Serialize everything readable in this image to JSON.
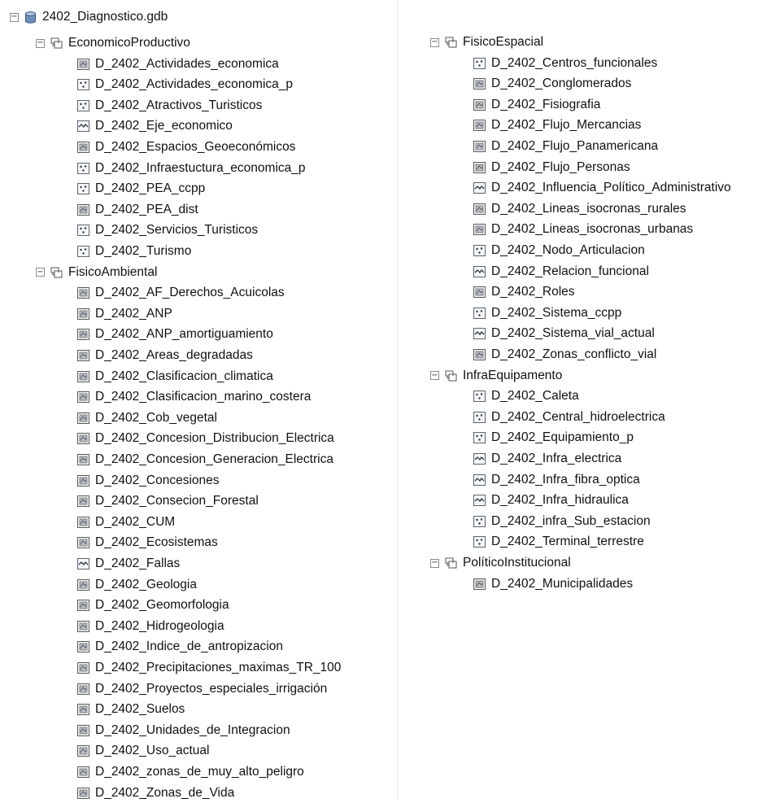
{
  "tree": {
    "root_label": "2402_Diagnostico.gdb",
    "root_toggle": "−",
    "datasets": [
      {
        "label": "EconomicoProductivo",
        "toggle": "−",
        "items": [
          {
            "label": "D_2402_Actividades_economica",
            "icon": "polygon-icon"
          },
          {
            "label": "D_2402_Actividades_economica_p",
            "icon": "point-icon"
          },
          {
            "label": "D_2402_Atractivos_Turisticos",
            "icon": "point-icon"
          },
          {
            "label": "D_2402_Eje_economico",
            "icon": "line-icon"
          },
          {
            "label": "D_2402_Espacios_Geoeconómicos",
            "icon": "polygon-icon"
          },
          {
            "label": "D_2402_Infraestuctura_economica_p",
            "icon": "point-icon"
          },
          {
            "label": "D_2402_PEA_ccpp",
            "icon": "point-icon"
          },
          {
            "label": "D_2402_PEA_dist",
            "icon": "polygon-icon"
          },
          {
            "label": "D_2402_Servicios_Turisticos",
            "icon": "point-icon"
          },
          {
            "label": "D_2402_Turismo",
            "icon": "point-icon"
          }
        ]
      },
      {
        "label": "FisicoAmbiental",
        "toggle": "−",
        "items": [
          {
            "label": "D_2402_AF_Derechos_Acuicolas",
            "icon": "polygon-icon"
          },
          {
            "label": "D_2402_ANP",
            "icon": "polygon-icon"
          },
          {
            "label": "D_2402_ANP_amortiguamiento",
            "icon": "polygon-icon"
          },
          {
            "label": "D_2402_Areas_degradadas",
            "icon": "polygon-icon"
          },
          {
            "label": "D_2402_Clasificacion_climatica",
            "icon": "polygon-icon"
          },
          {
            "label": "D_2402_Clasificacion_marino_costera",
            "icon": "polygon-icon"
          },
          {
            "label": "D_2402_Cob_vegetal",
            "icon": "polygon-icon"
          },
          {
            "label": "D_2402_Concesion_Distribucion_Electrica",
            "icon": "polygon-icon"
          },
          {
            "label": "D_2402_Concesion_Generacion_Electrica",
            "icon": "polygon-icon"
          },
          {
            "label": "D_2402_Concesiones",
            "icon": "polygon-icon"
          },
          {
            "label": "D_2402_Consecion_Forestal",
            "icon": "polygon-icon"
          },
          {
            "label": "D_2402_CUM",
            "icon": "polygon-icon"
          },
          {
            "label": "D_2402_Ecosistemas",
            "icon": "polygon-icon"
          },
          {
            "label": "D_2402_Fallas",
            "icon": "line-icon"
          },
          {
            "label": "D_2402_Geologia",
            "icon": "polygon-icon"
          },
          {
            "label": "D_2402_Geomorfologia",
            "icon": "polygon-icon"
          },
          {
            "label": "D_2402_Hidrogeologia",
            "icon": "polygon-icon"
          },
          {
            "label": "D_2402_Indice_de_antropizacion",
            "icon": "polygon-icon"
          },
          {
            "label": "D_2402_Precipitaciones_maximas_TR_100",
            "icon": "polygon-icon"
          },
          {
            "label": "D_2402_Proyectos_especiales_irrigación",
            "icon": "polygon-icon"
          },
          {
            "label": "D_2402_Suelos",
            "icon": "polygon-icon"
          },
          {
            "label": "D_2402_Unidades_de_Integracion",
            "icon": "polygon-icon"
          },
          {
            "label": "D_2402_Uso_actual",
            "icon": "polygon-icon"
          },
          {
            "label": "D_2402_zonas_de_muy_alto_peligro",
            "icon": "polygon-icon"
          },
          {
            "label": "D_2402_Zonas_de_Vida",
            "icon": "polygon-icon"
          }
        ]
      },
      {
        "label": "FisicoEspacial",
        "toggle": "−",
        "items": [
          {
            "label": "D_2402_Centros_funcionales",
            "icon": "point-icon"
          },
          {
            "label": "D_2402_Conglomerados",
            "icon": "polygon-icon"
          },
          {
            "label": "D_2402_Fisiografia",
            "icon": "polygon-icon"
          },
          {
            "label": "D_2402_Flujo_Mercancias",
            "icon": "polygon-icon"
          },
          {
            "label": "D_2402_Flujo_Panamericana",
            "icon": "polygon-icon"
          },
          {
            "label": "D_2402_Flujo_Personas",
            "icon": "polygon-icon"
          },
          {
            "label": "D_2402_Influencia_Político_Administrativo",
            "icon": "line-icon"
          },
          {
            "label": "D_2402_Lineas_isocronas_rurales",
            "icon": "polygon-icon"
          },
          {
            "label": "D_2402_Lineas_isocronas_urbanas",
            "icon": "polygon-icon"
          },
          {
            "label": "D_2402_Nodo_Articulacion",
            "icon": "point-icon"
          },
          {
            "label": "D_2402_Relacion_funcional",
            "icon": "line-icon"
          },
          {
            "label": "D_2402_Roles",
            "icon": "polygon-icon"
          },
          {
            "label": "D_2402_Sistema_ccpp",
            "icon": "point-icon"
          },
          {
            "label": "D_2402_Sistema_vial_actual",
            "icon": "line-icon"
          },
          {
            "label": "D_2402_Zonas_conflicto_vial",
            "icon": "polygon-icon"
          }
        ]
      },
      {
        "label": "InfraEquipamento",
        "toggle": "−",
        "items": [
          {
            "label": "D_2402_Caleta",
            "icon": "point-icon"
          },
          {
            "label": "D_2402_Central_hidroelectrica",
            "icon": "point-icon"
          },
          {
            "label": "D_2402_Equipamiento_p",
            "icon": "point-icon"
          },
          {
            "label": "D_2402_Infra_electrica",
            "icon": "line-icon"
          },
          {
            "label": "D_2402_Infra_fibra_optica",
            "icon": "line-icon"
          },
          {
            "label": "D_2402_Infra_hidraulica",
            "icon": "line-icon"
          },
          {
            "label": "D_2402_infra_Sub_estacion",
            "icon": "point-icon"
          },
          {
            "label": "D_2402_Terminal_terrestre",
            "icon": "point-icon"
          }
        ]
      },
      {
        "label": "PolíticoInstitucional",
        "toggle": "−",
        "items": [
          {
            "label": "D_2402_Municipalidades",
            "icon": "polygon-icon"
          }
        ]
      }
    ]
  }
}
